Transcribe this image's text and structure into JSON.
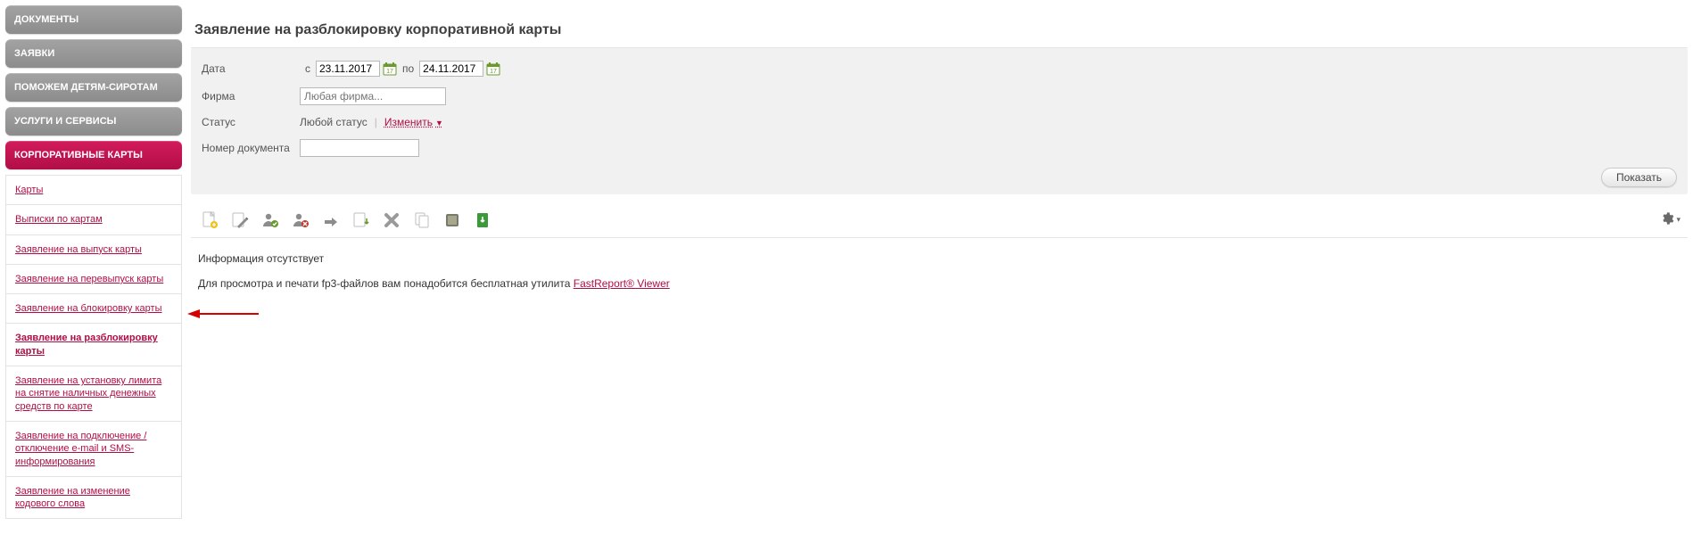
{
  "nav": {
    "items": [
      {
        "label": "ДОКУМЕНТЫ"
      },
      {
        "label": "ЗАЯВКИ"
      },
      {
        "label": "ПОМОЖЕМ ДЕТЯМ-СИРОТАМ"
      },
      {
        "label": "УСЛУГИ И СЕРВИСЫ"
      },
      {
        "label": "КОРПОРАТИВНЫЕ КАРТЫ"
      }
    ],
    "sub": [
      {
        "label": "Карты"
      },
      {
        "label": "Выписки по картам"
      },
      {
        "label": "Заявление на выпуск карты"
      },
      {
        "label": "Заявление на перевыпуск карты"
      },
      {
        "label": "Заявление на блокировку карты"
      },
      {
        "label": "Заявление на разблокировку карты"
      },
      {
        "label": "Заявление на установку лимита на снятие наличных денежных средств по карте"
      },
      {
        "label": "Заявление на подключение / отключение e-mail и SMS-информирования"
      },
      {
        "label": "Заявление на изменение кодового слова"
      }
    ]
  },
  "page": {
    "title": "Заявление на разблокировку корпоративной карты"
  },
  "filter": {
    "date_label": "Дата",
    "date_from_prefix": "с",
    "date_from": "23.11.2017",
    "date_to_prefix": "по",
    "date_to": "24.11.2017",
    "firm_label": "Фирма",
    "firm_placeholder": "Любая фирма...",
    "status_label": "Статус",
    "status_value": "Любой статус",
    "status_change": "Изменить",
    "docnum_label": "Номер документа",
    "show_button": "Показать"
  },
  "results": {
    "empty_text": "Информация отсутствует",
    "helper_text": "Для просмотра и печати fp3-файлов вам понадобится бесплатная утилита ",
    "helper_link": "FastReport® Viewer"
  }
}
